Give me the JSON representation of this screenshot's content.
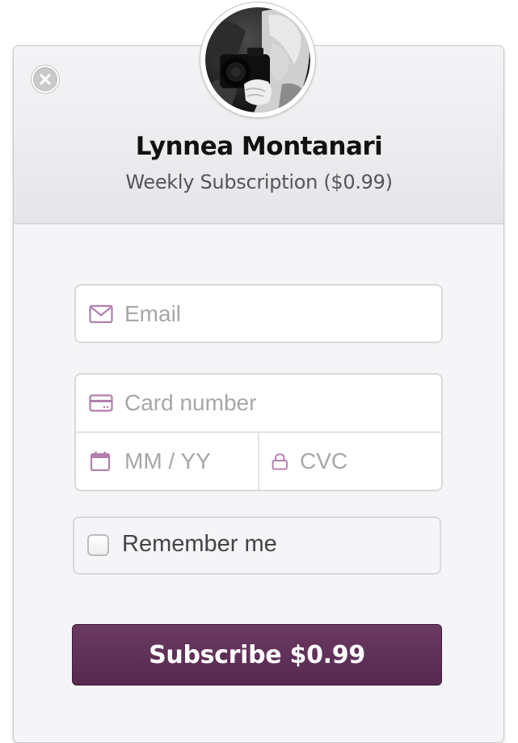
{
  "header": {
    "merchant_name": "Lynnea Montanari",
    "plan_description": "Weekly Subscription ($0.99)"
  },
  "form": {
    "email_placeholder": "Email",
    "card_number_placeholder": "Card number",
    "expiry_placeholder": "MM / YY",
    "cvc_placeholder": "CVC",
    "remember_label": "Remember me",
    "remember_checked": false,
    "submit_label": "Subscribe $0.99"
  },
  "icons": {
    "close": "close-icon",
    "email": "envelope-icon",
    "card": "credit-card-icon",
    "expiry": "calendar-icon",
    "cvc": "lock-icon"
  },
  "colors": {
    "accent": "#5e2f57",
    "icon_tint": "#b27fae"
  }
}
